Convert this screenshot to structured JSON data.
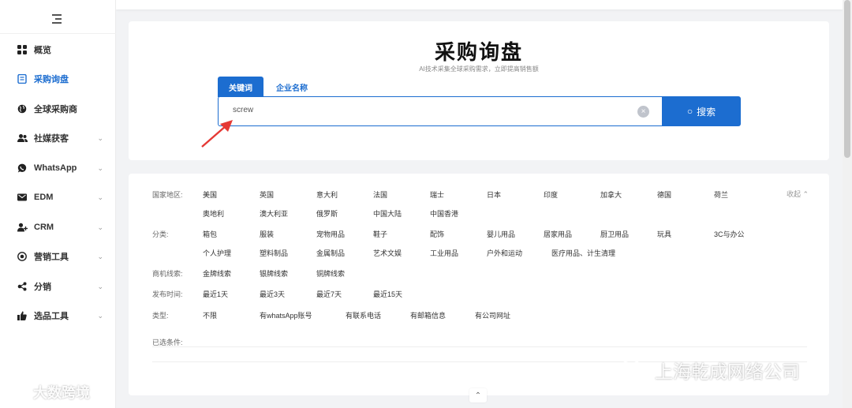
{
  "sidebar": {
    "items": [
      {
        "label": "概览",
        "icon": "grid-icon",
        "active": false,
        "expandable": false
      },
      {
        "label": "采购询盘",
        "icon": "list-icon",
        "active": true,
        "expandable": false
      },
      {
        "label": "全球采购商",
        "icon": "globe-icon",
        "active": false,
        "expandable": false
      },
      {
        "label": "社媒获客",
        "icon": "users-icon",
        "active": false,
        "expandable": true
      },
      {
        "label": "WhatsApp",
        "icon": "whatsapp-icon",
        "active": false,
        "expandable": true
      },
      {
        "label": "EDM",
        "icon": "mail-icon",
        "active": false,
        "expandable": true
      },
      {
        "label": "CRM",
        "icon": "user-plus-icon",
        "active": false,
        "expandable": true
      },
      {
        "label": "营销工具",
        "icon": "target-icon",
        "active": false,
        "expandable": true
      },
      {
        "label": "分销",
        "icon": "share-icon",
        "active": false,
        "expandable": true
      },
      {
        "label": "选品工具",
        "icon": "thumbs-up-icon",
        "active": false,
        "expandable": true
      }
    ]
  },
  "search": {
    "title": "采购询盘",
    "subtitle": "AI技术采集全球采购需求，立即提高销售额",
    "tabs": [
      {
        "label": "关键词",
        "active": true
      },
      {
        "label": "企业名称",
        "active": false
      }
    ],
    "query": "screw",
    "button_label": "搜索",
    "clear_glyph": "×",
    "search_glyph": "○"
  },
  "filters": {
    "collapse_label": "收起",
    "country": {
      "label": "国家地区:",
      "options": [
        "美国",
        "英国",
        "意大利",
        "法国",
        "瑞士",
        "日本",
        "印度",
        "加拿大",
        "德国",
        "荷兰",
        "奥地利",
        "澳大利亚",
        "俄罗斯",
        "中国大陆",
        "中国香港"
      ]
    },
    "category": {
      "label": "分类:",
      "options": [
        "箱包",
        "服装",
        "宠物用品",
        "鞋子",
        "配饰",
        "婴儿用品",
        "居家用品",
        "厨卫用品",
        "玩具",
        "3C与办公",
        "个人护理",
        "塑料制品",
        "金属制品",
        "艺术文娱",
        "工业用品",
        "户外和运动",
        "医疗用品、计生清理"
      ]
    },
    "leads": {
      "label": "商机线索:",
      "options": [
        "金牌线索",
        "银牌线索",
        "铜牌线索"
      ]
    },
    "published": {
      "label": "发布时间:",
      "options": [
        "最近1天",
        "最近3天",
        "最近7天",
        "最近15天"
      ]
    },
    "type": {
      "label": "类型:",
      "options": [
        "不限",
        "有whatsApp账号",
        "有联系电话",
        "有邮箱信息",
        "有公司网址"
      ]
    },
    "selected_label": "已选条件:"
  },
  "watermarks": {
    "left": "大数跨境",
    "right": "上海乾成网络公司"
  },
  "colors": {
    "accent": "#1c6dd0",
    "annotation": "#e53935"
  }
}
